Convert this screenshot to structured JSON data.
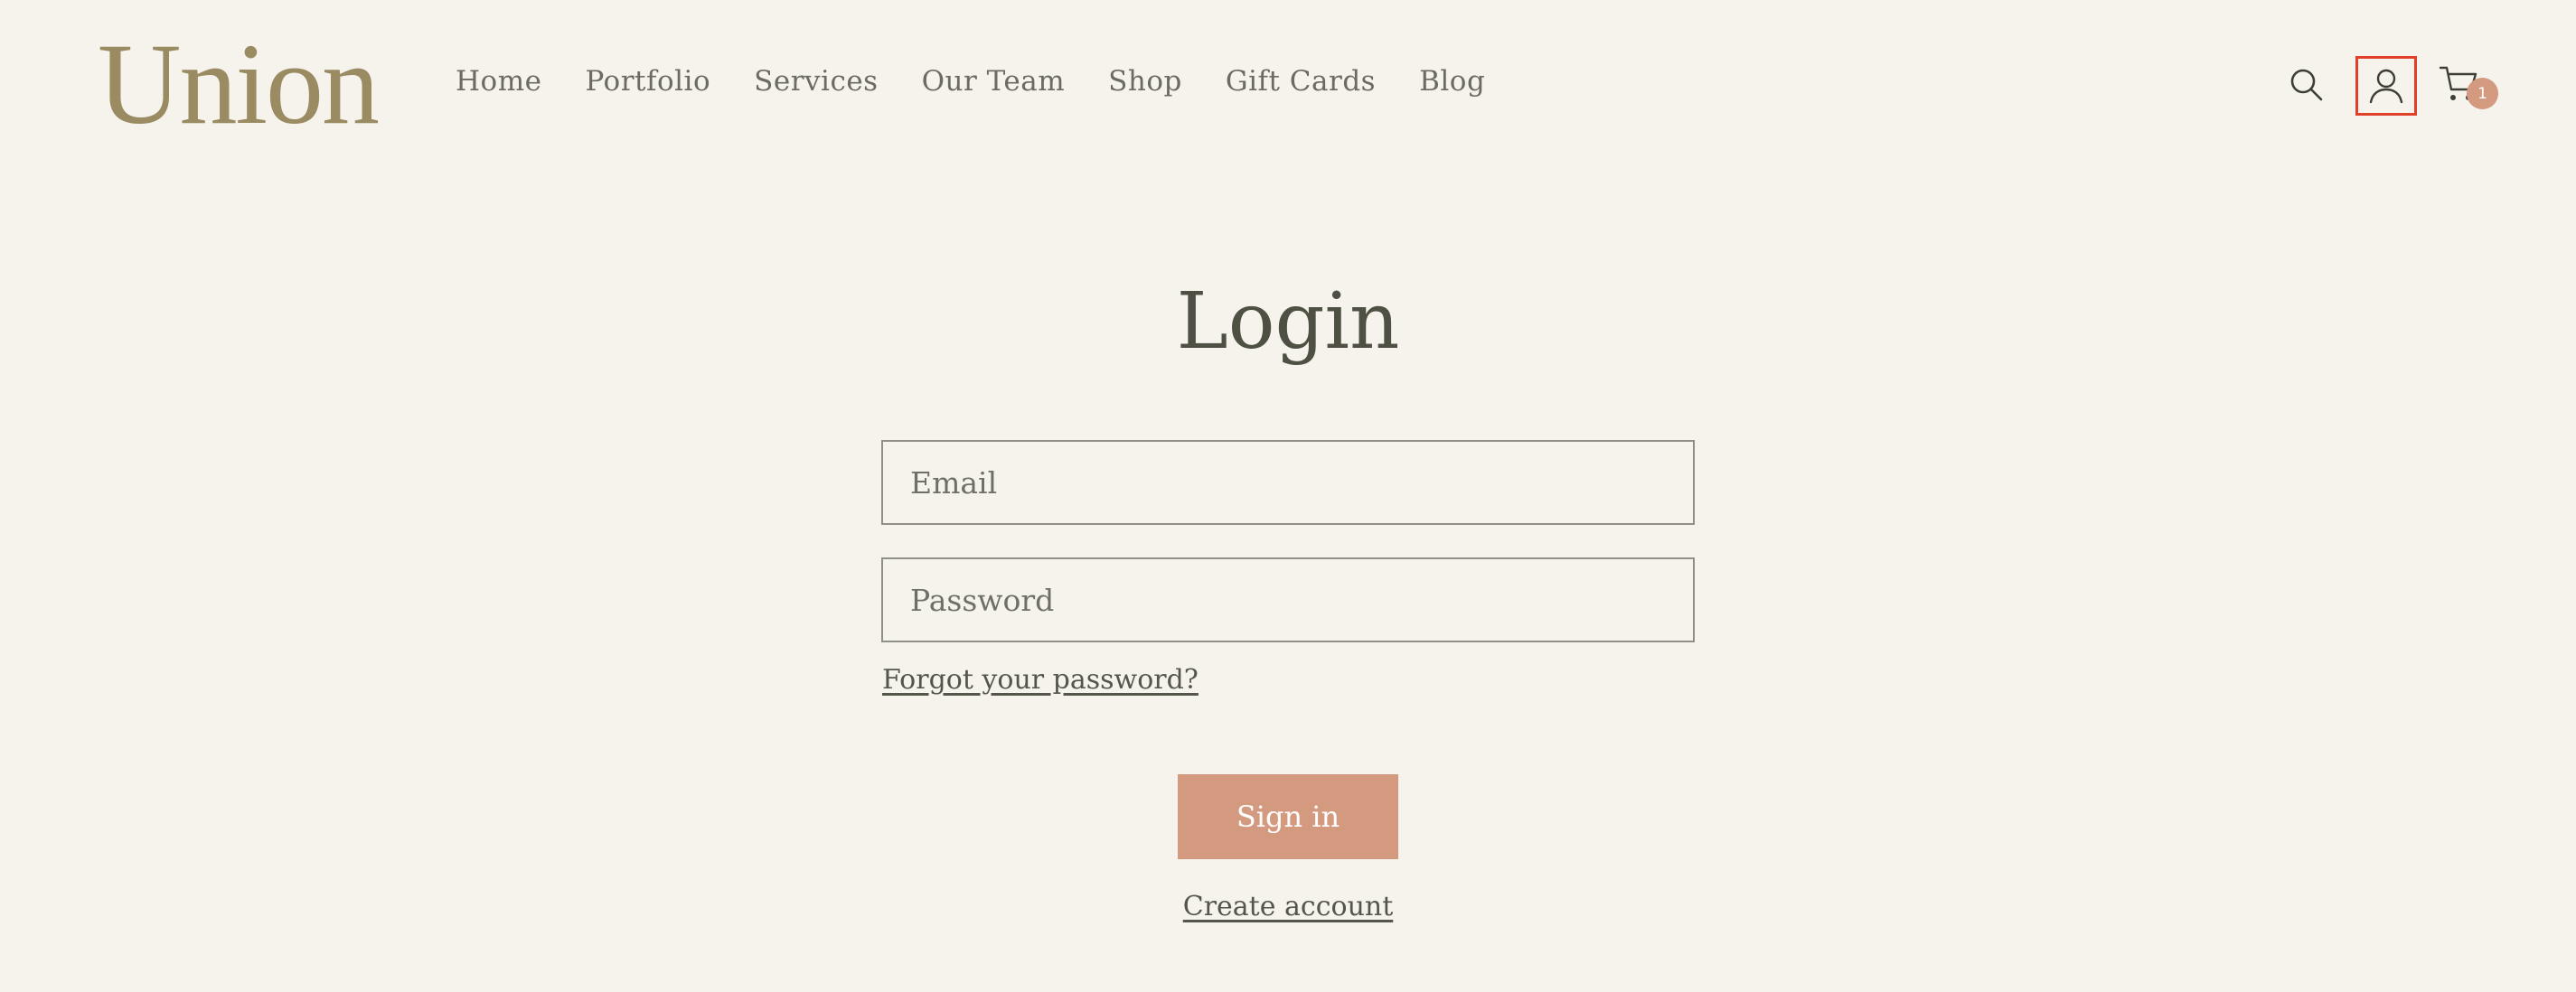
{
  "header": {
    "logo": "Union",
    "nav": [
      "Home",
      "Portfolio",
      "Services",
      "Our Team",
      "Shop",
      "Gift Cards",
      "Blog"
    ],
    "icons": [
      "search-icon",
      "account-icon",
      "cart-icon"
    ],
    "cart_count": "1"
  },
  "login": {
    "title": "Login",
    "email_placeholder": "Email",
    "password_placeholder": "Password",
    "forgot_label": "Forgot your password?",
    "signin_label": "Sign in",
    "create_label": "Create account"
  },
  "colors": {
    "background": "#f6f3ec",
    "logo": "#9b8b62",
    "accent": "#d49a80",
    "highlight": "#e0402a"
  }
}
